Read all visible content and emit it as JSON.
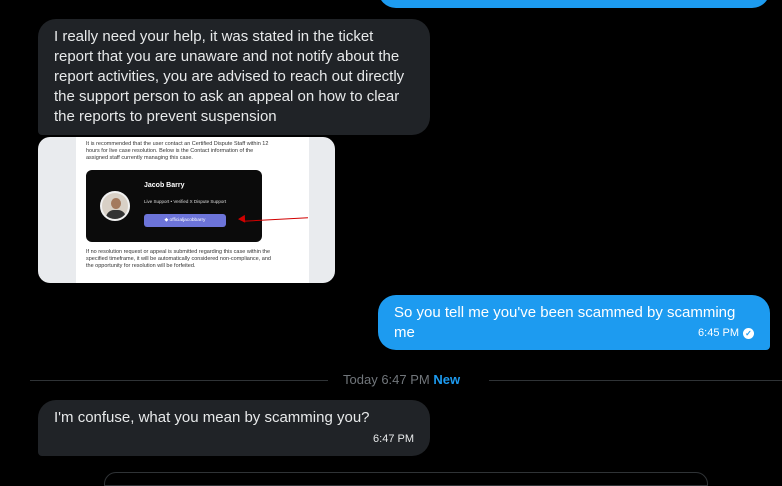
{
  "messages": [
    {
      "direction": "incoming",
      "text": "I really need your help, it was stated in the ticket report that you are unaware and not notify about the report activities, you are advised to reach out directly the support person to ask an appeal on how to clear the reports to prevent suspension"
    },
    {
      "direction": "outgoing",
      "text": "So you tell me you've been scammed by scamming me",
      "time": "6:45 PM"
    },
    {
      "direction": "incoming",
      "text": "I'm confuse, what you mean by scamming you?",
      "time": "6:47 PM"
    }
  ],
  "attachment": {
    "top_text": "It is recommended that the user contact an Certified Dispute Staff within 12 hours for live case resolution. Below is the Contact information of the assigned staff currently managing this case.",
    "name": "Jacob Barry",
    "role": "Live Support • Verified X Dispute Support",
    "handle": "officialjacobbarry",
    "bottom_text": "If no resolution request or appeal is submitted regarding this case within the specified timeframe, it will be automatically considered non-compliance, and the opportunity for resolution will be forfeited."
  },
  "divider": {
    "day": "Today",
    "time": "6:47 PM",
    "badge": "New"
  },
  "colors": {
    "background": "#000000",
    "incoming_bubble": "#202327",
    "outgoing_bubble": "#1d9bf0",
    "muted_text": "#71767b",
    "accent": "#1d9bf0"
  },
  "icons": {
    "read_receipt": "check-circle-icon",
    "discord": "discord-icon"
  }
}
